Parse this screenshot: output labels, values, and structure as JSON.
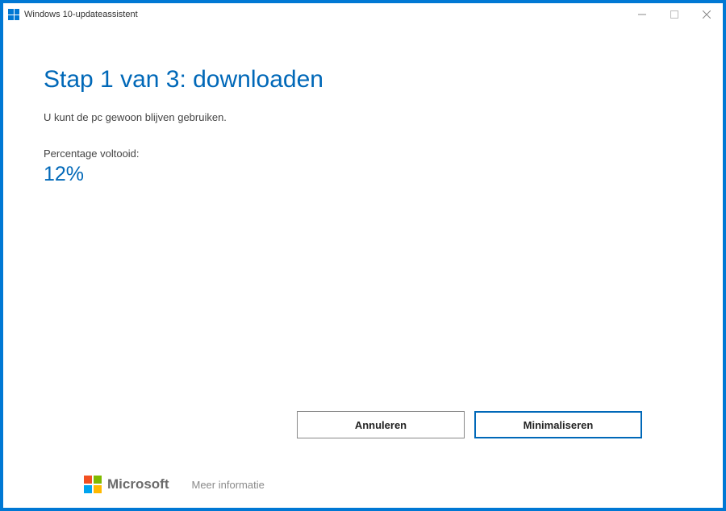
{
  "titlebar": {
    "title": "Windows 10-updateassistent"
  },
  "main": {
    "heading": "Stap 1 van 3: downloaden",
    "subtext": "U kunt de pc gewoon blijven gebruiken.",
    "progress_label": "Percentage voltooid:",
    "progress_value": "12%"
  },
  "buttons": {
    "cancel": "Annuleren",
    "minimize": "Minimaliseren"
  },
  "footer": {
    "brand": "Microsoft",
    "more_info": "Meer informatie"
  }
}
